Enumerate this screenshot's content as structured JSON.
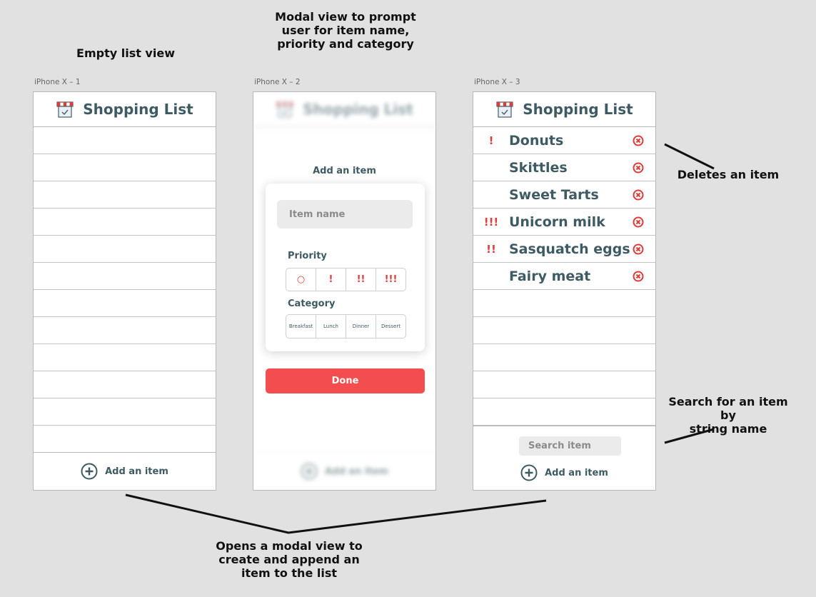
{
  "annotations": {
    "empty_list_view": "Empty list view",
    "modal_view": [
      "Modal view to prompt",
      "user for item name,",
      "priority and category"
    ],
    "deletes_item": "Deletes an item",
    "search_item": [
      "Search for an item by",
      "string name"
    ],
    "opens_modal": [
      "Opens a modal view to",
      "create and append an",
      "item to the list"
    ]
  },
  "frames": {
    "one": "iPhone X – 1",
    "two": "iPhone X – 2",
    "three": "iPhone X – 3"
  },
  "app": {
    "title": "Shopping List",
    "icon": "storefront-icon",
    "add_item_label": "Add an item",
    "add_icon": "plus-circle-icon"
  },
  "modal": {
    "title": "Add an item",
    "name_placeholder": "Item name",
    "priority_label": "Priority",
    "priority_options": [
      "○",
      "!",
      "!!",
      "!!!"
    ],
    "category_label": "Category",
    "category_options": [
      "Breakfast",
      "Lunch",
      "Dinner",
      "Dessert"
    ],
    "done_label": "Done"
  },
  "list": {
    "items": [
      {
        "priority": "!",
        "name": "Donuts"
      },
      {
        "priority": "",
        "name": "Skittles"
      },
      {
        "priority": "",
        "name": "Sweet Tarts"
      },
      {
        "priority": "!!!",
        "name": "Unicorn milk"
      },
      {
        "priority": "!!",
        "name": "Sasquatch eggs"
      },
      {
        "priority": "",
        "name": "Fairy meat"
      }
    ],
    "delete_icon": "delete-circle-icon",
    "search_placeholder": "Search item"
  },
  "colors": {
    "accent": "#f44d4f",
    "text_primary": "#3e5b63",
    "background": "#e1e1e1"
  }
}
